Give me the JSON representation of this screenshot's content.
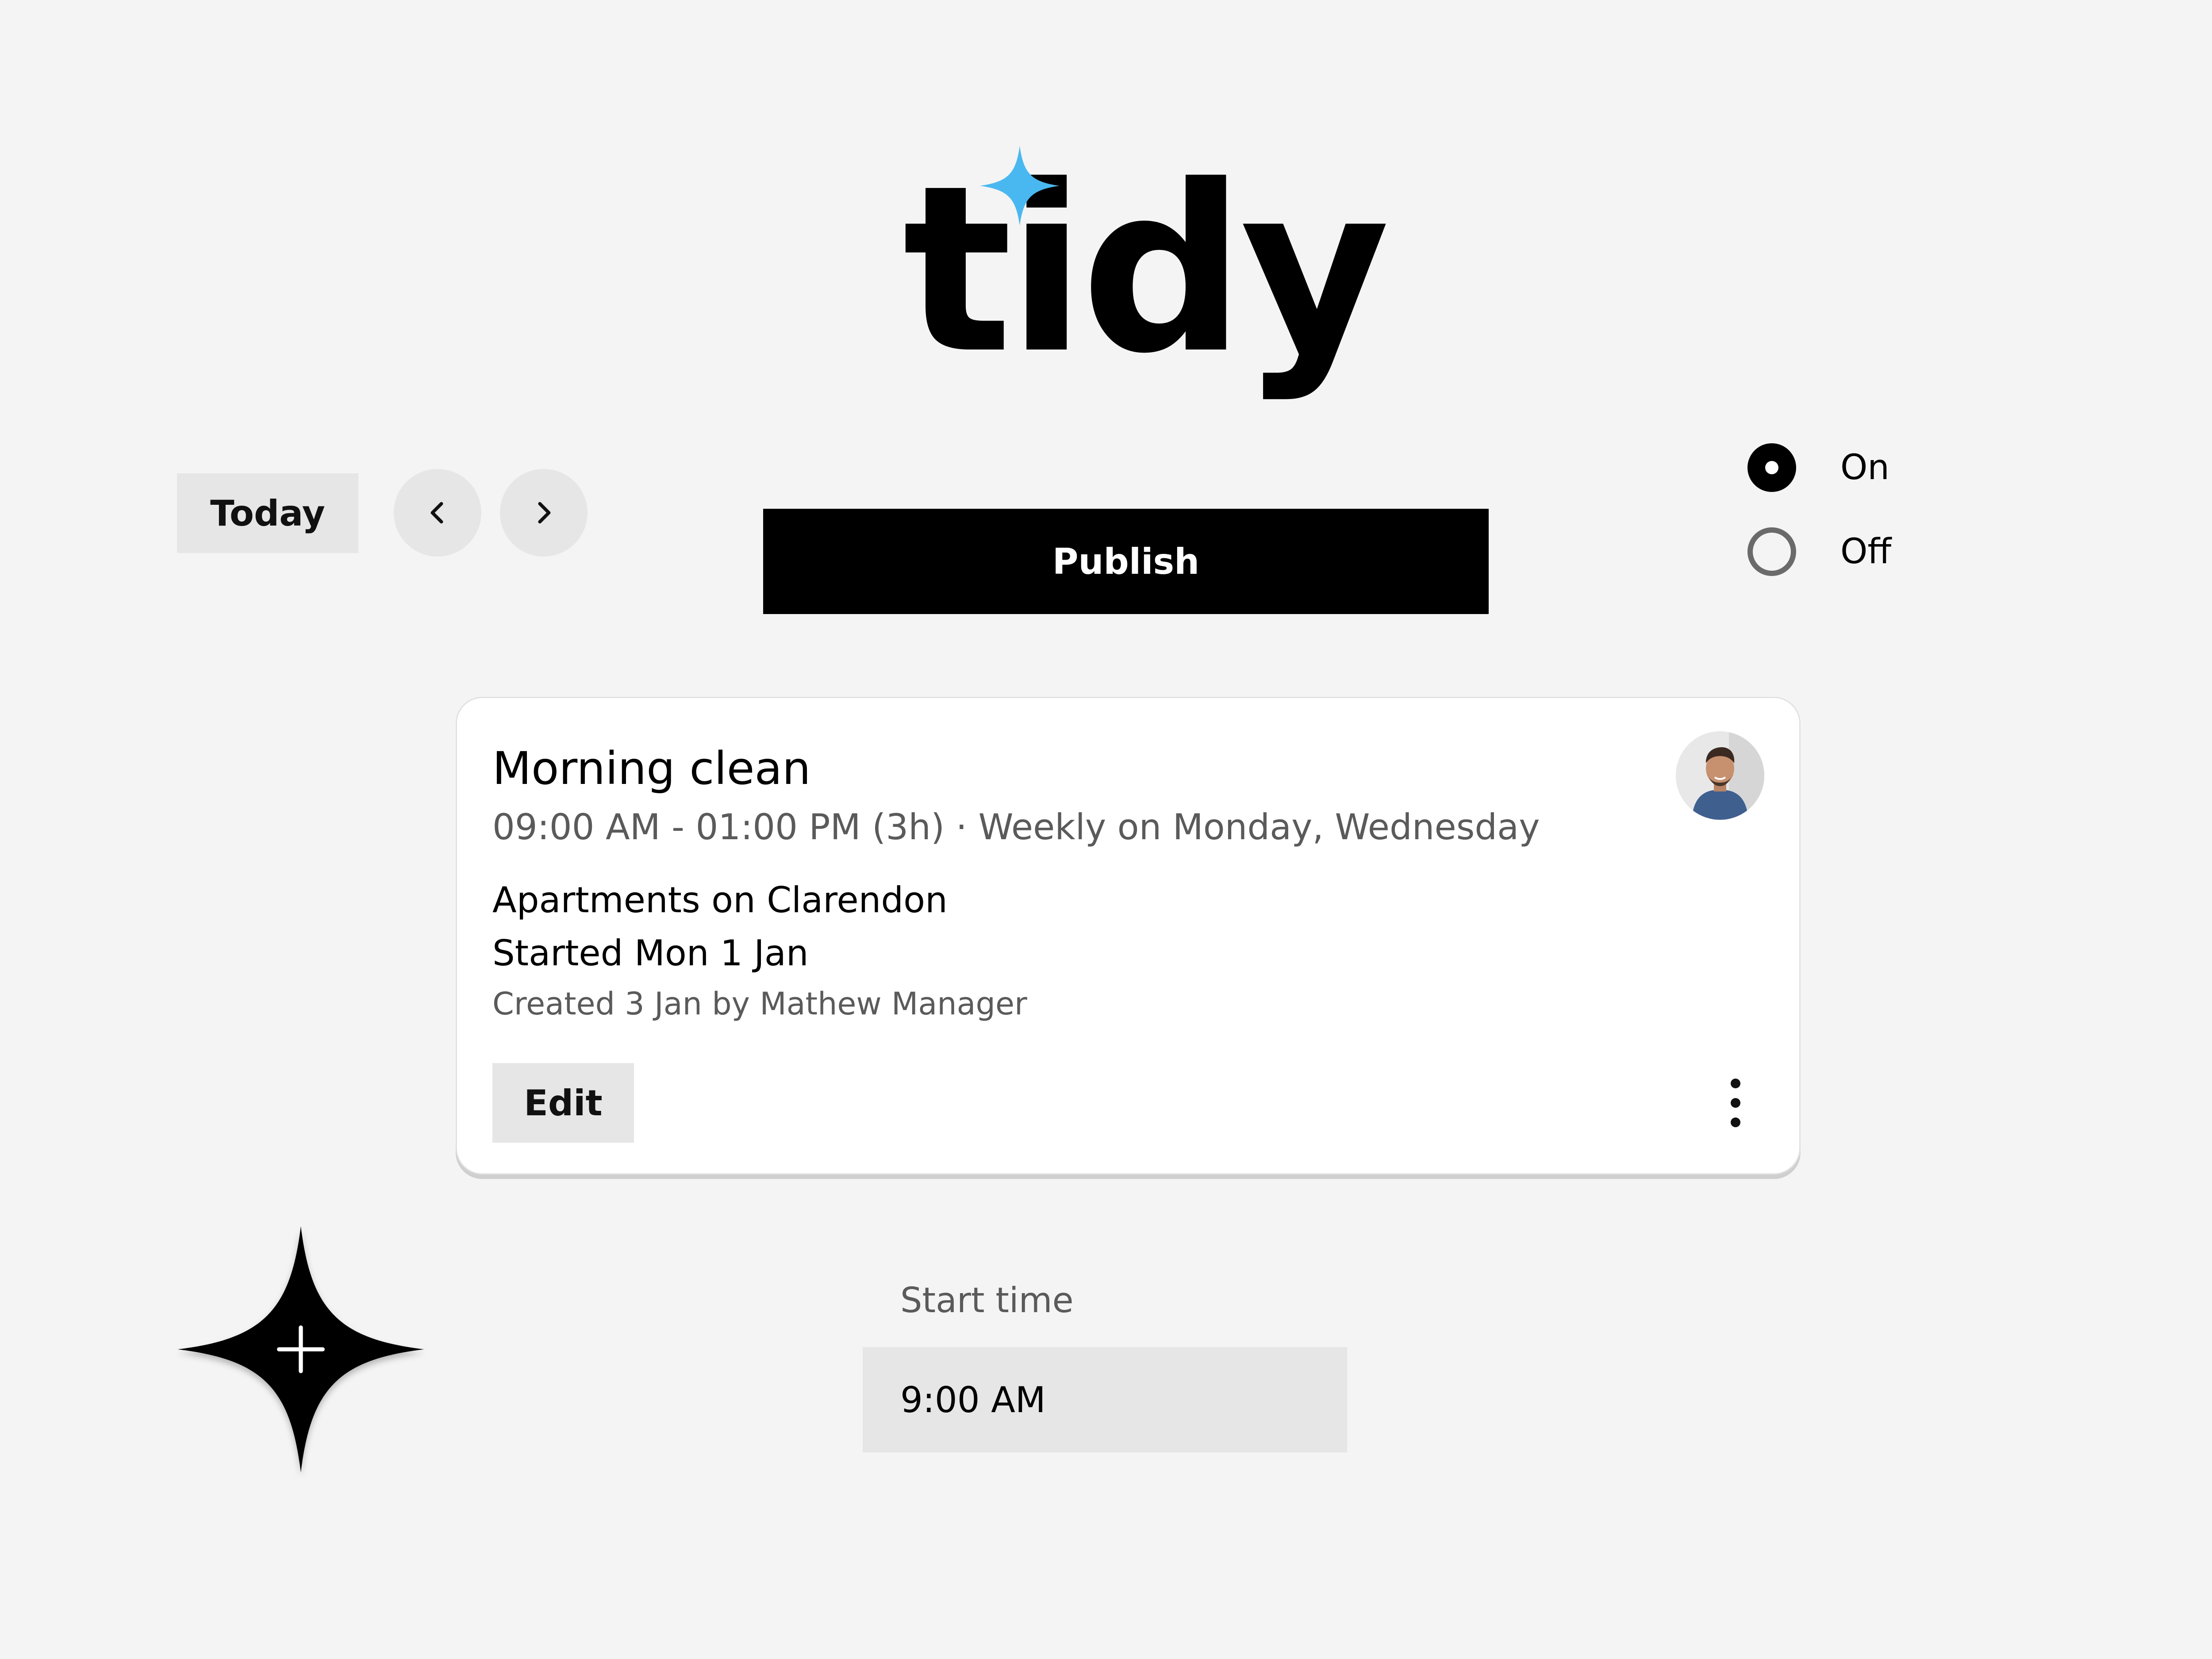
{
  "logo": {
    "text": "tidy",
    "spark_color": "#4ab8f0"
  },
  "toolbar": {
    "today_label": "Today",
    "prev_icon": "chevron-left-icon",
    "next_icon": "chevron-right-icon",
    "publish_label": "Publish"
  },
  "visibility": {
    "options": [
      {
        "label": "On",
        "checked": true
      },
      {
        "label": "Off",
        "checked": false
      }
    ]
  },
  "card": {
    "title": "Morning clean",
    "subtitle": "09:00 AM - 01:00 PM (3h) · Weekly on Monday, Wednesday",
    "location": "Apartments on Clarendon",
    "started": "Started Mon  1 Jan",
    "created": "Created  3 Jan by Mathew Manager",
    "edit_label": "Edit",
    "more_icon": "more-vertical-icon",
    "avatar_icon": "user-avatar"
  },
  "fab": {
    "icon": "plus-icon"
  },
  "start_time": {
    "label": "Start time",
    "value": "9:00 AM"
  }
}
